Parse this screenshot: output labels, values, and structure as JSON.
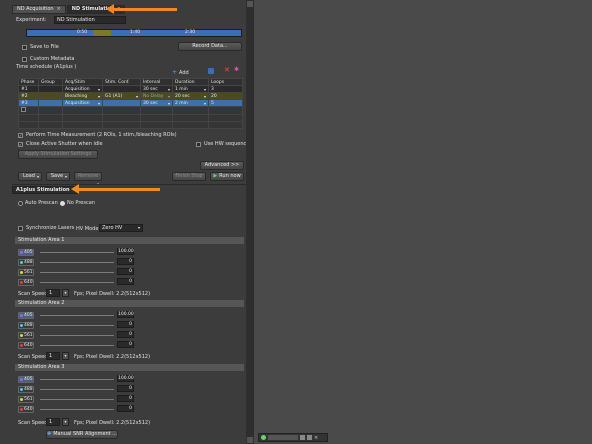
{
  "tabs": [
    {
      "label": "ND Acquisition"
    },
    {
      "label": "ND Stimulation"
    }
  ],
  "experiment": {
    "label": "Experiment:",
    "value": "ND Stimulation"
  },
  "timeline": {
    "ticks": [
      "0:50",
      "1:40",
      "2:30"
    ]
  },
  "save_to_file": "Save to File",
  "record_data_btn": "Record Data...",
  "custom_metadata": "Custom Metadata",
  "time_schedule": {
    "title": "Time schedule (A1plus )",
    "add_label": "Add",
    "columns": [
      "Phase",
      "Group",
      "Acq/Stim",
      "Stim. Conf.",
      "Interval",
      "Duration",
      "Loops"
    ],
    "rows": [
      {
        "phase": "#1",
        "group": "",
        "acq": "Acquisition",
        "conf": "",
        "interval": "30 sec",
        "duration": "1 min",
        "loops": "3"
      },
      {
        "phase": "#2",
        "group": "",
        "acq": "Bleaching",
        "conf": "G1 (A1)",
        "interval": "No Delay",
        "duration": "20 sec",
        "loops": "20"
      },
      {
        "phase": "#3",
        "group": "",
        "acq": "Acquisition",
        "conf": "",
        "interval": "30 sec",
        "duration": "2 min",
        "loops": "5"
      }
    ]
  },
  "perform_time": "Perform Time Measurement (2 ROIs, 1 stim./bleaching ROIs)",
  "open_shutter": "Close Active Shutter when idle",
  "use_hw": "Use HW sequencer",
  "apply_stim_btn": "Apply Stimulation Settings",
  "advanced_btn": "Advanced >>",
  "load_btn": "Load",
  "save_btn": "Save",
  "remove_btn": "Remove",
  "finish_btn": "Finish Stop",
  "run_btn": "Run now",
  "stim_panel_title": "A1plus Stimulation",
  "auto_prescan": "Auto Prescan",
  "no_prescan": "No Prescan",
  "sync_lasers": "Synchronize Lasers",
  "hv_mode": {
    "label": "HV Mode:",
    "value": "Zero HV"
  },
  "areas": [
    {
      "title": "Stimulation Area 1",
      "lasers": [
        {
          "nm": "405",
          "val": "100.00"
        },
        {
          "nm": "488",
          "val": "0"
        },
        {
          "nm": "561",
          "val": "0"
        },
        {
          "nm": "640",
          "val": "0"
        }
      ],
      "scan_label": "Scan Speed",
      "scan_value": "1",
      "fps": "Fps; Pixel Dwell: 2.2(512x512)"
    },
    {
      "title": "Stimulation Area 2",
      "lasers": [
        {
          "nm": "405",
          "val": "100.00"
        },
        {
          "nm": "488",
          "val": "0"
        },
        {
          "nm": "561",
          "val": "0"
        },
        {
          "nm": "640",
          "val": "0"
        }
      ],
      "scan_label": "Scan Speed",
      "scan_value": "1",
      "fps": "Fps; Pixel Dwell: 2.2(512x512)"
    },
    {
      "title": "Stimulation Area 3",
      "lasers": [
        {
          "nm": "405",
          "val": "100.00"
        },
        {
          "nm": "488",
          "val": "0"
        },
        {
          "nm": "561",
          "val": "0"
        },
        {
          "nm": "640",
          "val": "0"
        }
      ],
      "scan_label": "Scan Speed",
      "scan_value": "1",
      "fps": "Fps; Pixel Dwell: 2.2(512x512)"
    }
  ],
  "manual_align_btn": "Manual SNR Alignment ...",
  "colors": {
    "arrow": "#f08a1e",
    "selected_row": "#3a6fb0",
    "timeline": "#3d6db5"
  }
}
